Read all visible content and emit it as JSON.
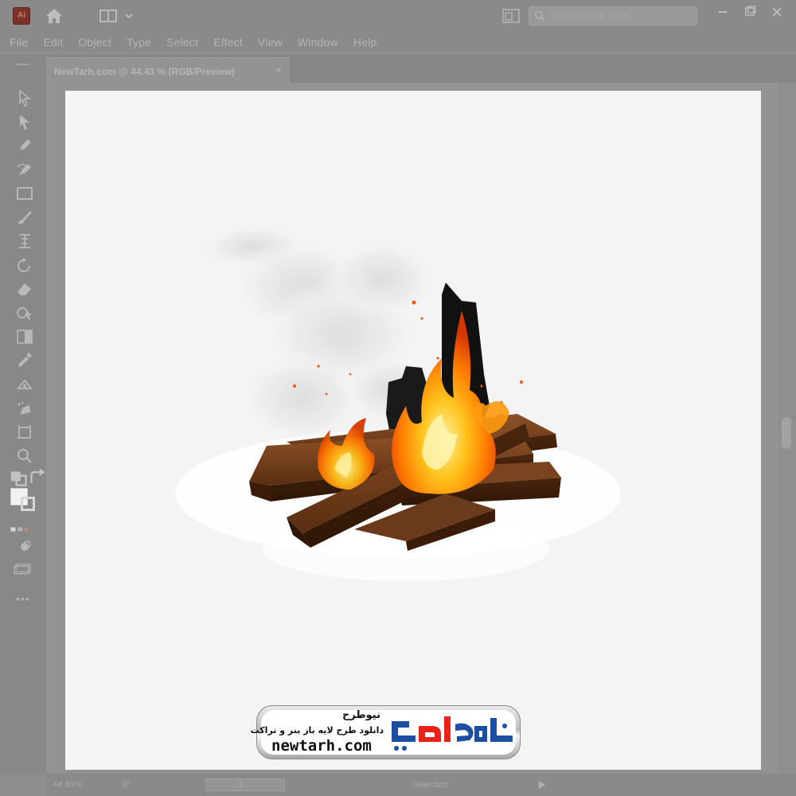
{
  "app": {
    "logo_text": "Ai",
    "search_placeholder": "Search Adobe Stock",
    "window_controls": [
      "minimize-icon",
      "restore-icon",
      "close-icon"
    ]
  },
  "menubar": {
    "items": [
      "File",
      "Edit",
      "Object",
      "Type",
      "Select",
      "Effect",
      "View",
      "Window",
      "Help"
    ]
  },
  "document": {
    "tab_label": "NewTarh.com @ 44.43 % (RGB/Preview)",
    "close_glyph": "×"
  },
  "toolbar": {
    "tools": [
      "selection-tool-icon",
      "direct-selection-tool-icon",
      "pen-tool-icon",
      "curvature-tool-icon",
      "rectangle-tool-icon",
      "paintbrush-tool-icon",
      "width-tool-icon",
      "rotate-tool-icon",
      "eraser-tool-icon",
      "shape-builder-tool-icon",
      "gradient-tool-icon",
      "eyedropper-tool-icon",
      "blend-tool-icon",
      "symbol-sprayer-tool-icon",
      "artboard-tool-icon",
      "zoom-tool-icon"
    ],
    "more_label": "•••"
  },
  "statusbar": {
    "zoom": "44.43%",
    "rotation": "0°",
    "artboard_number": "1",
    "active_tool": "Selection"
  },
  "watermark": {
    "brand_fa": "نیوطرح",
    "tagline_fa": "دانلود طرح لایه باز بنر و تراکت",
    "url": "newtarh.com",
    "logo_text_fa": "نیوطرح"
  },
  "colors": {
    "ui_overlay": "#8e8e8e",
    "artboard": "#f4f4f4",
    "flame_outer": "#ff8c00",
    "flame_inner": "#ffd23a",
    "wood": "#6b3a1c",
    "logo_red": "#e5231b",
    "logo_blue": "#1c4fa1"
  }
}
